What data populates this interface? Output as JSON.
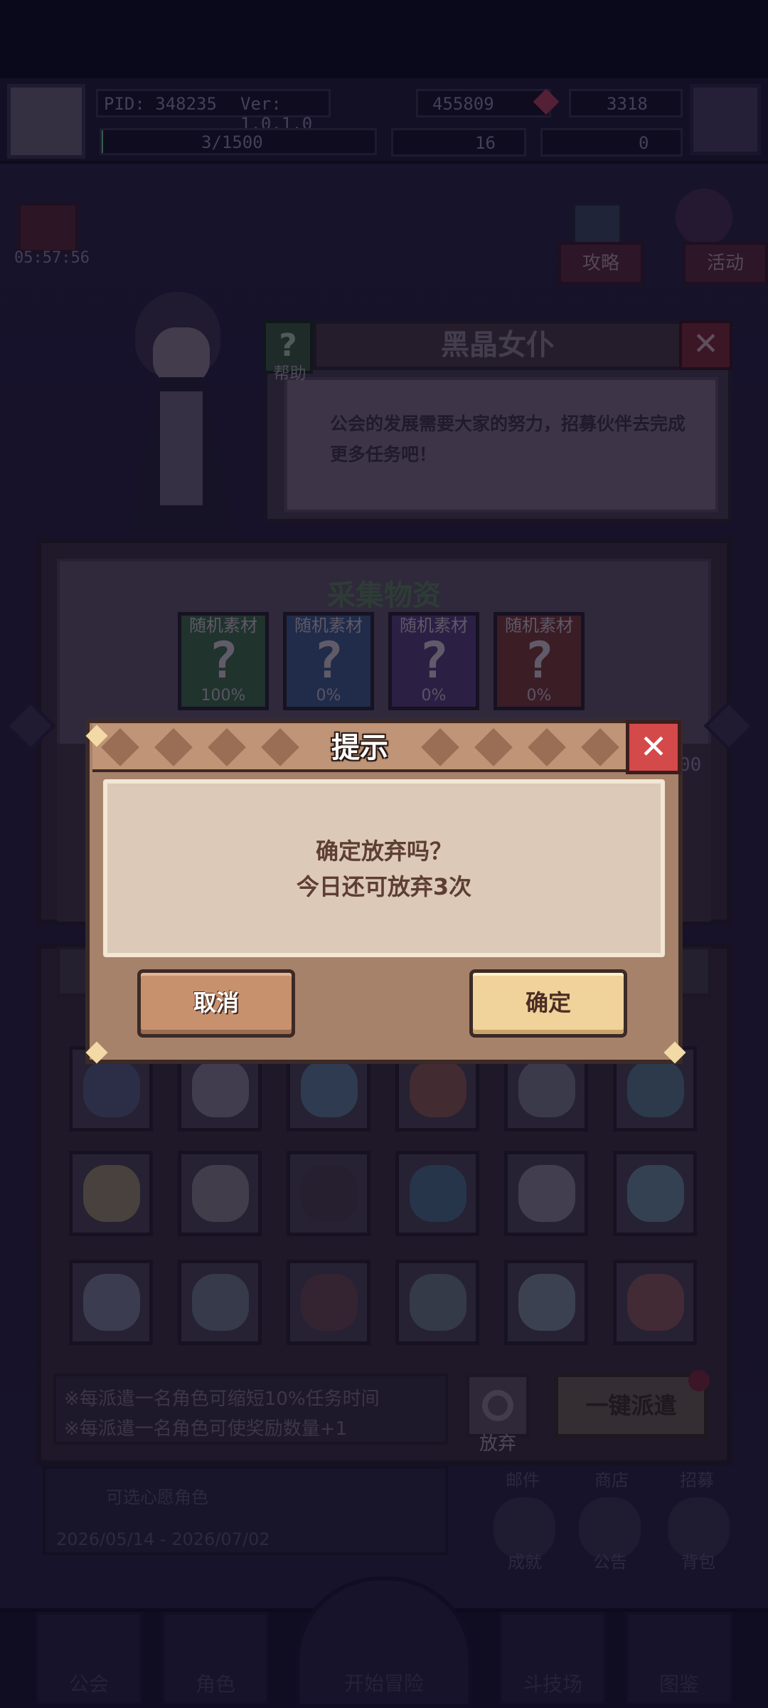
{
  "topbar": {
    "pid": "PID: 348235",
    "version": "Ver: 1.0.1.0",
    "gold": "455809",
    "gems": "3318",
    "exp": "3/1500",
    "res_a": "16",
    "res_b": "0",
    "timer": "05:57:56"
  },
  "side_buttons": {
    "guide": "攻略",
    "activity": "活动"
  },
  "npc": {
    "title": "黑晶女仆",
    "help_label": "帮助",
    "message": "公会的发展需要大家的努力，招募伙伴去完成更多任务吧！",
    "help_icon": "question-mark-icon",
    "close_icon": "close-x-icon"
  },
  "task": {
    "title": "采集物资",
    "materials": [
      {
        "label": "随机素材",
        "pct": "100%",
        "color": "#3f6b47"
      },
      {
        "label": "随机素材",
        "pct": "0%",
        "color": "#3f5b85"
      },
      {
        "label": "随机素材",
        "pct": "0%",
        "color": "#5a3f7a"
      },
      {
        "label": "随机素材",
        "pct": "0%",
        "color": "#7a3a38"
      }
    ],
    "right_value": "00"
  },
  "squad": {
    "hints": [
      "※每派遣一名角色可缩短10%任务时间",
      "※每派遣一名角色可使奖励数量+1"
    ],
    "giveup_label": "放弃",
    "dispatch_label": "一键派遣"
  },
  "banner": {
    "text": "可选心愿角色",
    "dates": "2026/05/14 - 2026/07/02"
  },
  "side_icons": {
    "mail": "邮件",
    "shop": "商店",
    "recruit": "招募",
    "achievement": "成就",
    "notice": "公告",
    "bag": "背包"
  },
  "bottom_nav": {
    "guild": "公会",
    "roles": "角色",
    "adventure": "开始冒险",
    "arena": "斗技场",
    "atlas": "图鉴"
  },
  "modal": {
    "title": "提示",
    "line1": "确定放弃吗？",
    "line2": "今日还可放弃3次",
    "cancel": "取消",
    "confirm": "确定",
    "close_icon": "close-x-icon"
  },
  "colors": {
    "modal_frame": "#a7826a",
    "modal_body": "#dcc9b8",
    "confirm_button": "#f0d29b",
    "cancel_button": "#c8916e",
    "close_button": "#d44a4a"
  }
}
